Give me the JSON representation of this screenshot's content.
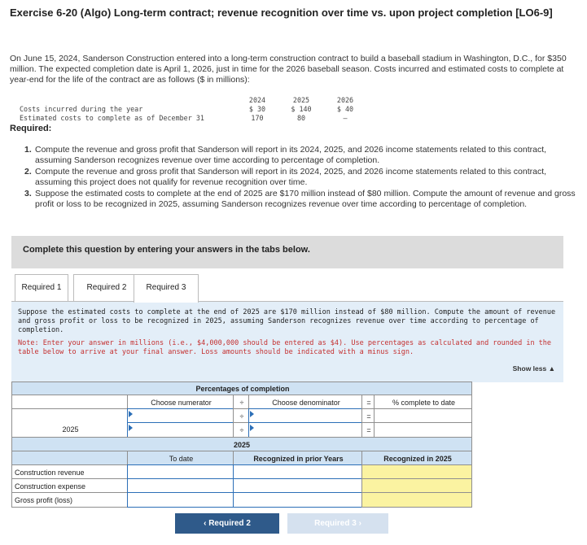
{
  "title": "Exercise 6-20 (Algo) Long-term contract; revenue recognition over time vs. upon project completion [LO6-9]",
  "intro": "On June 15, 2024, Sanderson Construction entered into a long-term construction contract to build a baseball stadium in Washington, D.C., for $350 million. The expected completion date is April 1, 2026, just in time for the 2026 baseball season. Costs incurred and estimated costs to complete at year-end for the life of the contract are as follows ($ in millions):",
  "costs_table": {
    "years": [
      "2024",
      "2025",
      "2026"
    ],
    "rows": [
      {
        "label": "Costs incurred during the year",
        "values": [
          "$ 30",
          "$ 140",
          "$ 40"
        ]
      },
      {
        "label": "Estimated costs to complete as of December 31",
        "values": [
          "170",
          "80",
          "–"
        ]
      }
    ]
  },
  "required_heading": "Required:",
  "requirements": [
    {
      "num": "1.",
      "text": "Compute the revenue and gross profit that Sanderson will report in its 2024, 2025, and 2026 income statements related to this contract, assuming Sanderson recognizes revenue over time according to percentage of completion."
    },
    {
      "num": "2.",
      "text": "Compute the revenue and gross profit that Sanderson will report in its 2024, 2025, and 2026 income statements related to this contract, assuming this project does not qualify for revenue recognition over time."
    },
    {
      "num": "3.",
      "text": "Suppose the estimated costs to complete at the end of 2025 are $170 million instead of $80 million. Compute the amount of revenue and gross profit or loss to be recognized in 2025, assuming Sanderson recognizes revenue over time according to percentage of completion."
    }
  ],
  "banner": "Complete this question by entering your answers in the tabs below.",
  "tabs": [
    "Required 1",
    "Required 2",
    "Required 3"
  ],
  "panel": {
    "text": "Suppose the estimated costs to complete at the end of 2025 are $170 million instead of $80 million. Compute the amount of revenue and gross profit or loss to be recognized in 2025, assuming Sanderson recognizes revenue over time according to percentage of completion.",
    "note": "Note: Enter your answer in millions (i.e., $4,000,000 should be entered as $4). Use percentages as calculated and rounded in the table below to arrive at your final answer. Loss amounts should be indicated with a minus sign.",
    "show_less": "Show less ▲"
  },
  "poc_table": {
    "title": "Percentages of completion",
    "col_numerator": "Choose numerator",
    "col_div": "÷",
    "col_denominator": "Choose denominator",
    "col_eq": "=",
    "col_result": "% complete to date",
    "year_label": "2025"
  },
  "rev_table": {
    "year": "2025",
    "col_to_date": "To date",
    "col_prior": "Recognized in prior Years",
    "col_current": "Recognized in 2025",
    "rows": [
      "Construction revenue",
      "Construction expense",
      "Gross profit (loss)"
    ]
  },
  "nav": {
    "prev": "Required 2",
    "next": "Required 3"
  },
  "colors": {
    "header_blue": "#cfe2f3",
    "input_border": "#2c6fb7",
    "highlight_yellow": "#fbf3a1",
    "note_red": "#c43030",
    "nav_button": "#2f5a8a"
  }
}
